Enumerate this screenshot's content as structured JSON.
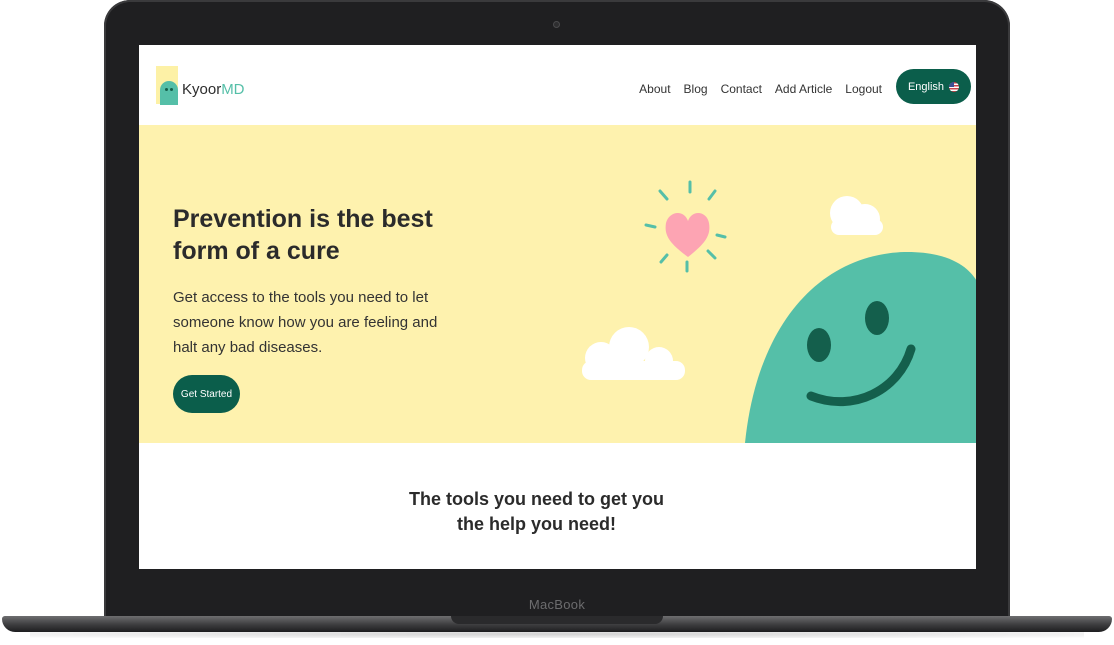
{
  "device": {
    "label": "MacBook"
  },
  "nav": {
    "logo_text": "Kyoor",
    "logo_accent": "MD",
    "links": [
      "About",
      "Blog",
      "Contact",
      "Add Article",
      "Logout"
    ],
    "language_label": "English"
  },
  "hero": {
    "title_line1": "Prevention is the best",
    "title_line2": "form of a cure",
    "subtitle": "Get access to the tools you need to let someone know how you are feeling and halt any bad diseases.",
    "cta_label": "Get Started"
  },
  "section2": {
    "title_line1": "The tools you need to get you",
    "title_line2": "the help you need!"
  },
  "colors": {
    "brand_dark": "#0b5e4b",
    "brand_teal": "#55bfa8",
    "hero_bg": "#fef2ae",
    "heart": "#fda4b3"
  }
}
